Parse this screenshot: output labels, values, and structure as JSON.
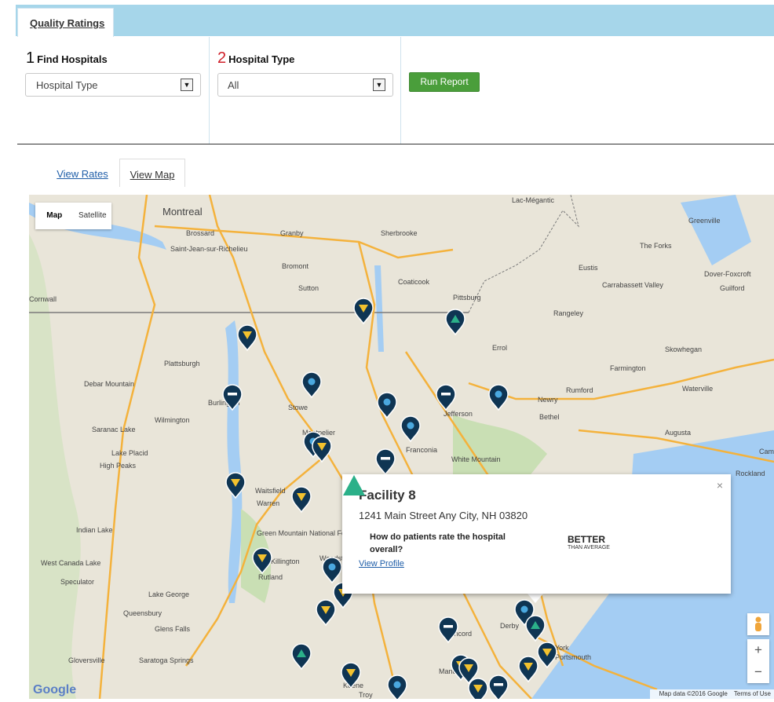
{
  "tabs": {
    "quality": "Quality Ratings"
  },
  "filters": {
    "find": {
      "step": "1",
      "label": "Find Hospitals",
      "value": "Hospital Type"
    },
    "type": {
      "step": "2",
      "label": "Hospital Type",
      "value": "All"
    },
    "run_label": "Run Report"
  },
  "view_tabs": {
    "rates": "View Rates",
    "map": "View Map"
  },
  "map": {
    "type_map": "Map",
    "type_satellite": "Satellite",
    "logo": "Google",
    "attribution": "Map data ©2016 Google",
    "terms": "Terms of Use",
    "zoom_in": "+",
    "zoom_out": "−",
    "places": [
      "Montreal",
      "Brossard",
      "Saint-Jean-sur-Richelieu",
      "Granby",
      "Sherbrooke",
      "Bromont",
      "Sutton",
      "Coaticook",
      "Pittsburg",
      "Lac-Mégantic",
      "Greenville",
      "The Forks",
      "Eustis",
      "Carrabassett Valley",
      "Dover-Foxcroft",
      "Guilford",
      "Rangeley",
      "Skowhegan",
      "Farmington",
      "Errol",
      "Plattsburgh",
      "Burlington",
      "Stowe",
      "Montpelier",
      "Jefferson",
      "Rumford",
      "Newry",
      "Bethel",
      "Waterville",
      "Augusta",
      "Camden",
      "Rockland",
      "Wilmington",
      "Saranac Lake",
      "Lake Placid",
      "High Peaks",
      "Debar Mountain",
      "Waitsfield",
      "Warren",
      "Franconia",
      "White Mountain",
      "Green Mountain National Forest",
      "Indian Lake",
      "West Canada Lake",
      "Speculator",
      "Killington",
      "Woodstock",
      "Rutland",
      "Lake George",
      "Queensbury",
      "Glens Falls",
      "Saratoga Springs",
      "Gloversville",
      "Keene",
      "Concord",
      "Manchester",
      "Portsmouth",
      "York",
      "Cornwall",
      "Derby",
      "Troy"
    ],
    "pins": [
      {
        "kind": "yellow"
      },
      {
        "kind": "teal"
      },
      {
        "kind": "yellow"
      },
      {
        "kind": "blue"
      },
      {
        "kind": "minus"
      },
      {
        "kind": "blue"
      },
      {
        "kind": "minus"
      },
      {
        "kind": "blue"
      },
      {
        "kind": "blue"
      },
      {
        "kind": "blue"
      },
      {
        "kind": "yellow"
      },
      {
        "kind": "minus"
      },
      {
        "kind": "yellow"
      },
      {
        "kind": "yellow"
      },
      {
        "kind": "yellow"
      },
      {
        "kind": "blue"
      },
      {
        "kind": "yellow"
      },
      {
        "kind": "yellow"
      },
      {
        "kind": "blue"
      },
      {
        "kind": "teal"
      },
      {
        "kind": "minus"
      },
      {
        "kind": "teal"
      },
      {
        "kind": "yellow"
      },
      {
        "kind": "yellow"
      },
      {
        "kind": "yellow"
      },
      {
        "kind": "blue"
      },
      {
        "kind": "yellow"
      },
      {
        "kind": "yellow"
      },
      {
        "kind": "minus"
      },
      {
        "kind": "yellow"
      }
    ]
  },
  "popup": {
    "title": "Facility 8",
    "address": "1241 Main Street Any City, NH 03820",
    "question": "How do patients rate the hospital overall?",
    "rating": "BETTER",
    "rating_sub": "THAN AVERAGE",
    "link": "View Profile",
    "close": "×"
  },
  "colors": {
    "pin": "#0f3553",
    "yellow": "#f2c12e",
    "teal": "#2bb089",
    "blue": "#4aa8df",
    "run": "#4a9e3b",
    "header": "#a6d6ea"
  }
}
